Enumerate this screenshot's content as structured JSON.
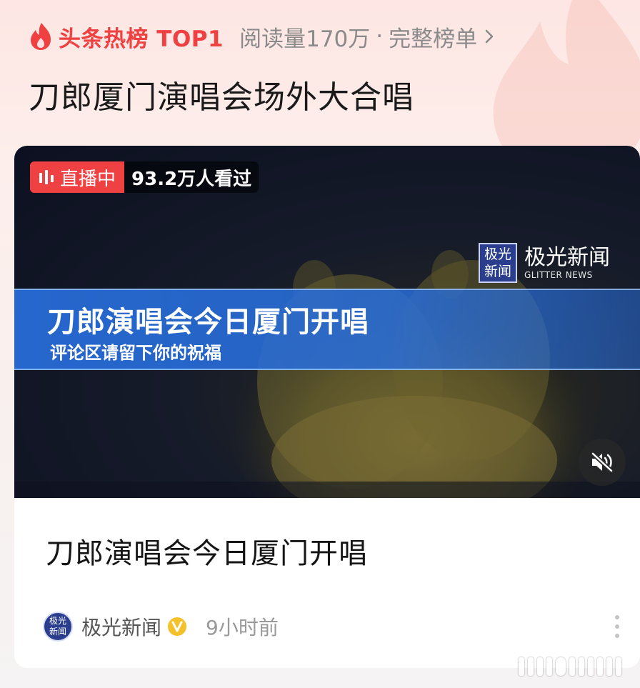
{
  "hot_header": {
    "label": "头条热榜 TOP1",
    "reads": "阅读量170万",
    "separator": "·",
    "full_list": "完整榜单",
    "accent_color": "#f04142",
    "icon": "flame-icon"
  },
  "topic": {
    "title": "刀郎厦门演唱会场外大合唱"
  },
  "video": {
    "live_label": "直播中",
    "viewers": "93.2万人看过",
    "brand": {
      "logo_line1": "极光",
      "logo_line2": "新闻",
      "name": "极光新闻",
      "name_en": "GLITTER NEWS"
    },
    "caption_main": "刀郎演唱会今日厦门开唱",
    "caption_sub": "评论区请留下你的祝福",
    "mute_icon": "speaker-muted-icon"
  },
  "article": {
    "title": "刀郎演唱会今日厦门开唱",
    "source": {
      "avatar_line1": "极光",
      "avatar_line2": "新闻",
      "name": "极光新闻",
      "time": "9小时前",
      "verified_icon": "verified-badge-icon",
      "more_icon": "more-vertical-icon"
    }
  }
}
